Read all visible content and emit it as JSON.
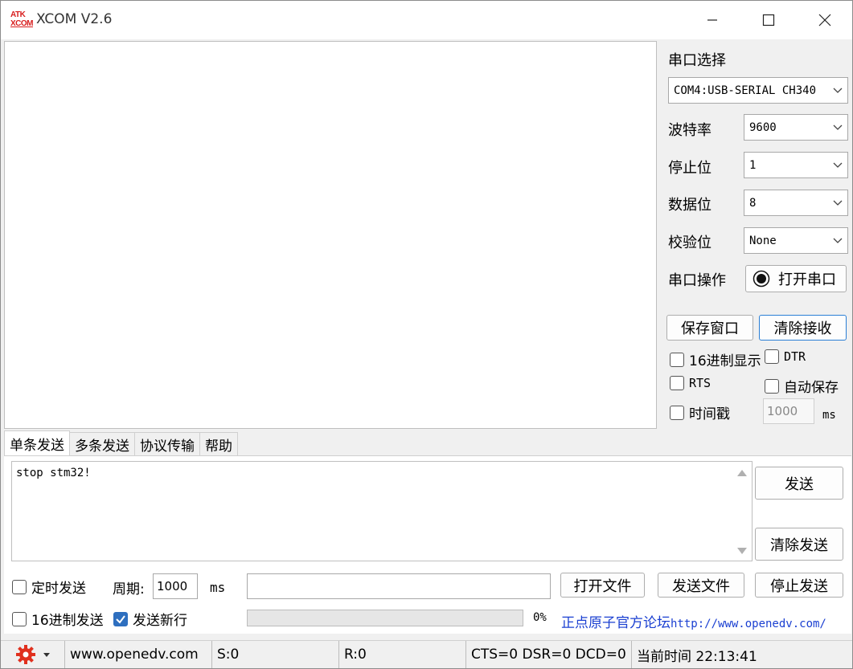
{
  "app": {
    "title": "XCOM V2.6",
    "logo_line1": "ATK",
    "logo_line2": "XCOM"
  },
  "serial": {
    "port_label": "串口选择",
    "port_value": "COM4:USB-SERIAL CH340",
    "baud_label": "波特率",
    "baud_value": "9600",
    "stop_label": "停止位",
    "stop_value": "1",
    "data_label": "数据位",
    "data_value": "8",
    "parity_label": "校验位",
    "parity_value": "None",
    "op_label": "串口操作",
    "open_button": "打开串口"
  },
  "recv_controls": {
    "save_window": "保存窗口",
    "clear_recv": "清除接收",
    "hex_display": "16进制显示",
    "dtr": "DTR",
    "rts": "RTS",
    "auto_save": "自动保存",
    "timestamp": "时间戳",
    "timestamp_value": "1000",
    "ms": "ms"
  },
  "tabs": [
    "单条发送",
    "多条发送",
    "协议传输",
    "帮助"
  ],
  "send": {
    "text": "stop stm32!",
    "send_button": "发送",
    "clear_send_button": "清除发送",
    "timed_send": "定时发送",
    "period_label": "周期:",
    "period_value": "1000",
    "period_unit": "ms",
    "file_path": "",
    "open_file": "打开文件",
    "send_file": "发送文件",
    "stop_send": "停止发送",
    "hex_send": "16进制发送",
    "send_newline": "发送新行",
    "progress_text": "0%",
    "progress_value": 0,
    "forum_link_text": "正点原子官方论坛",
    "forum_link_url": "http://www.openedv.com/"
  },
  "status": {
    "website": "www.openedv.com",
    "sent": "S:0",
    "received": "R:0",
    "lines": "CTS=0 DSR=0 DCD=0",
    "time": "当前时间 22:13:41"
  },
  "colors": {
    "accent": "#2e6fbf",
    "logo_red": "#d81e1e",
    "gear_red": "#e0301e",
    "link_blue": "#1a3fd1"
  }
}
